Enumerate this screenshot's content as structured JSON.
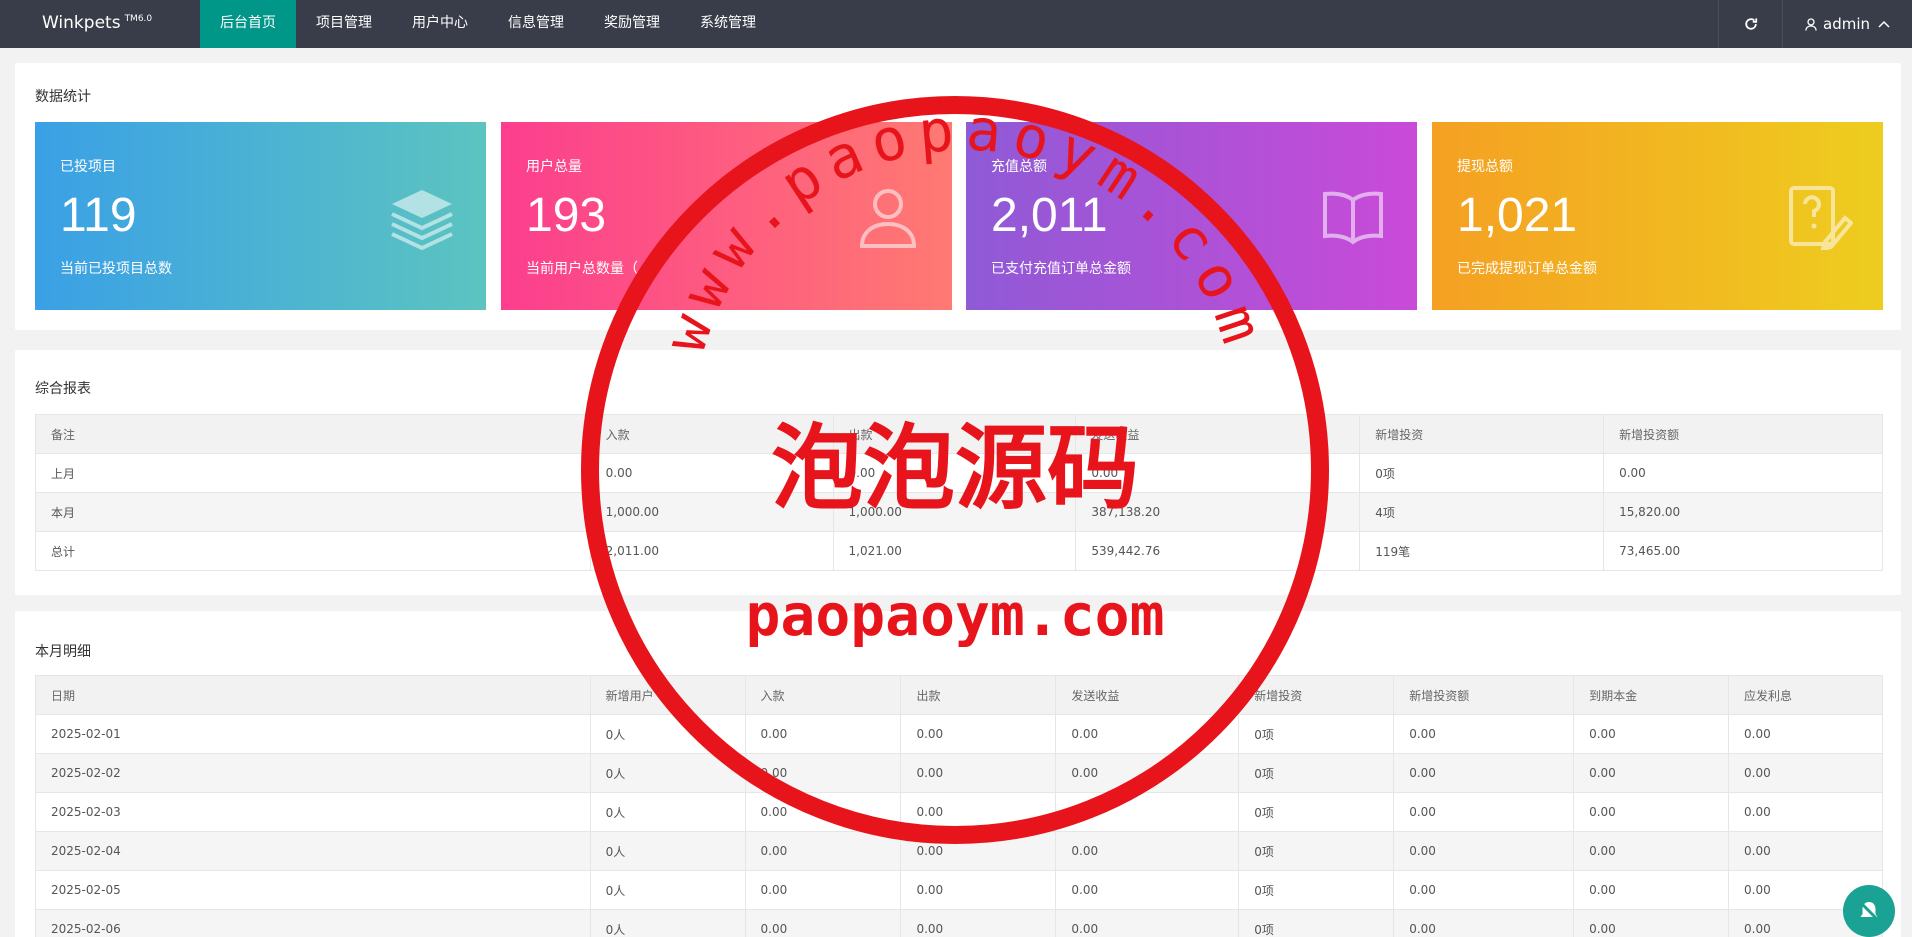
{
  "app": {
    "brand": "Winkpets",
    "version": "TM6.0"
  },
  "nav": [
    {
      "label": "后台首页",
      "active": true
    },
    {
      "label": "项目管理"
    },
    {
      "label": "用户中心"
    },
    {
      "label": "信息管理"
    },
    {
      "label": "奖励管理"
    },
    {
      "label": "系统管理"
    }
  ],
  "user": {
    "name": "admin"
  },
  "stats": {
    "title": "数据统计",
    "cards": [
      {
        "title": "已投项目",
        "value": "119",
        "sub": "当前已投项目总数",
        "icon": "layers-icon",
        "gradient": [
          "#3aa0e6",
          "#5cc4c0"
        ]
      },
      {
        "title": "用户总量",
        "value": "193",
        "sub": "当前用户总数量（人）",
        "icon": "users-icon",
        "gradient": [
          "#fc3e8e",
          "#ff7a72"
        ]
      },
      {
        "title": "充值总额",
        "value": "2,011",
        "sub": "已支付充值订单总金额",
        "icon": "book-icon",
        "gradient": [
          "#8f5ad6",
          "#c94ad8"
        ]
      },
      {
        "title": "提现总额",
        "value": "1,021",
        "sub": "已完成提现订单总金额",
        "icon": "edit-doc-icon",
        "gradient": [
          "#f5a023",
          "#eecd1f"
        ]
      }
    ]
  },
  "report": {
    "title": "综合报表",
    "headers": [
      "备注",
      "入款",
      "出款",
      "发送收益",
      "新增投资",
      "新增投资额"
    ],
    "rows": [
      [
        "上月",
        "0.00",
        "0.00",
        "0.00",
        "0项",
        "0.00"
      ],
      [
        "本月",
        "1,000.00",
        "1,000.00",
        "387,138.20",
        "4项",
        "15,820.00"
      ],
      [
        "总计",
        "2,011.00",
        "1,021.00",
        "539,442.76",
        "119笔",
        "73,465.00"
      ]
    ]
  },
  "monthly": {
    "title": "本月明细",
    "headers": [
      "日期",
      "新增用户",
      "入款",
      "出款",
      "发送收益",
      "新增投资",
      "新增投资额",
      "到期本金",
      "应发利息"
    ],
    "rows": [
      [
        "2025-02-01",
        "0人",
        "0.00",
        "0.00",
        "0.00",
        "0项",
        "0.00",
        "0.00",
        "0.00"
      ],
      [
        "2025-02-02",
        "0人",
        "0.00",
        "0.00",
        "0.00",
        "0项",
        "0.00",
        "0.00",
        "0.00"
      ],
      [
        "2025-02-03",
        "0人",
        "0.00",
        "0.00",
        "0.00",
        "0项",
        "0.00",
        "0.00",
        "0.00"
      ],
      [
        "2025-02-04",
        "0人",
        "0.00",
        "0.00",
        "0.00",
        "0项",
        "0.00",
        "0.00",
        "0.00"
      ],
      [
        "2025-02-05",
        "0人",
        "0.00",
        "0.00",
        "0.00",
        "0项",
        "0.00",
        "0.00",
        "0.00"
      ],
      [
        "2025-02-06",
        "0人",
        "0.00",
        "0.00",
        "0.00",
        "0项",
        "0.00",
        "0.00",
        "0.00"
      ]
    ]
  },
  "watermark": {
    "url_top": "www.paopaoym.com",
    "name": "泡泡源码",
    "url_bottom": "paopaoym.com",
    "color": "#e8141b"
  }
}
